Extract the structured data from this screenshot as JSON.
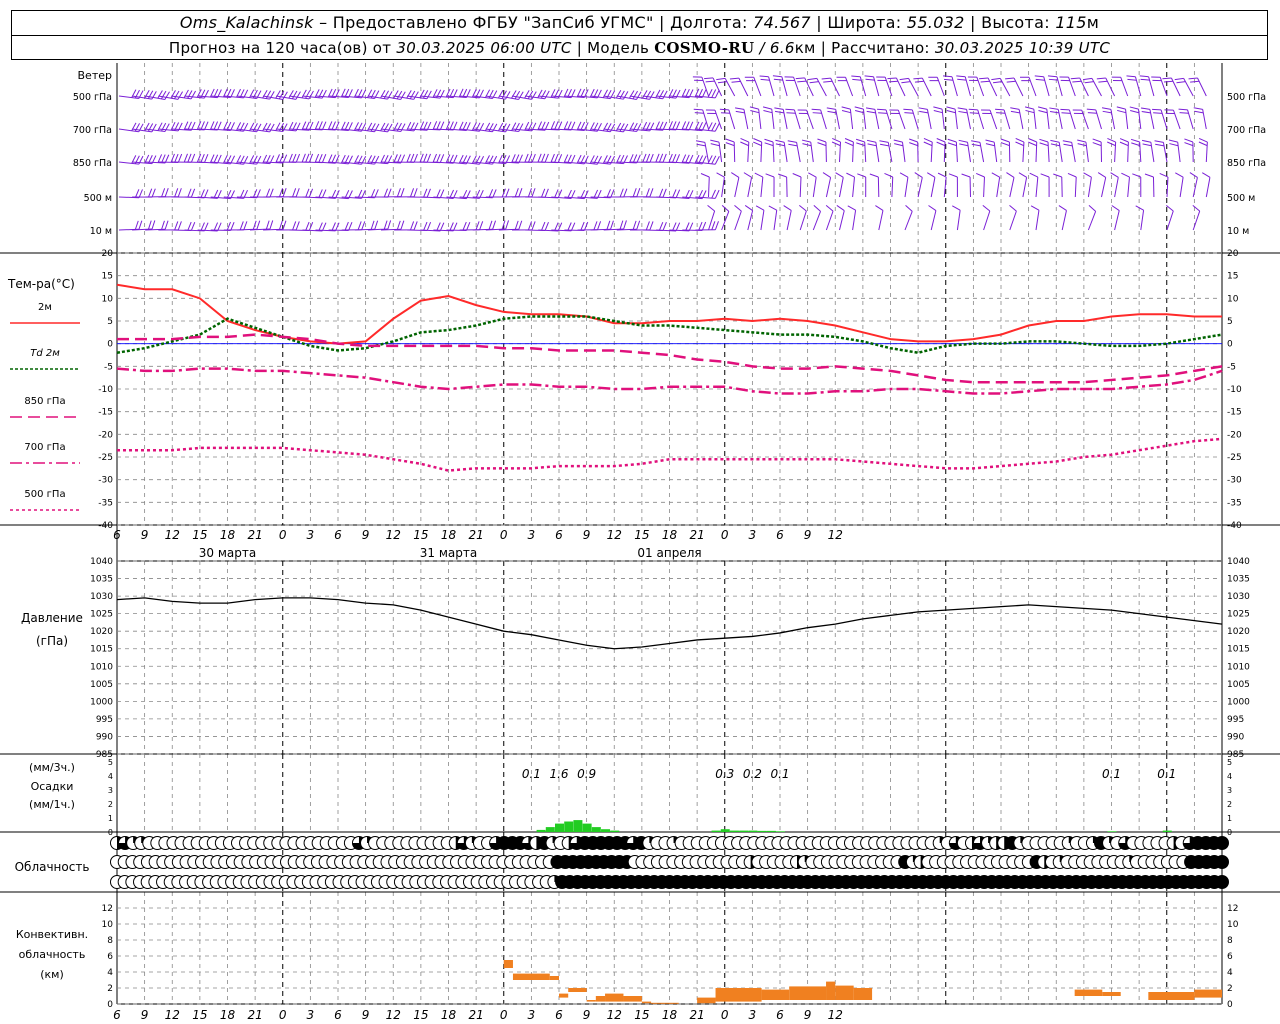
{
  "header": {
    "station": "Oms_Kalachinsk",
    "provided": "– Предоставлено ФГБУ \"ЗапСиб УГМС\"",
    "lon_label": "Долгота:",
    "lon": "74.567",
    "lat_label": "Широта:",
    "lat": "55.032",
    "alt_label": "Высота:",
    "alt": "115",
    "alt_unit": "м",
    "forecast_prefix": "Прогноз на 120 часа(ов) от",
    "forecast_time": "30.03.2025 06:00 UTC",
    "model_label": "Модель",
    "model": "COSMO-RU",
    "model_res": "/ 6.6",
    "model_res_unit": "км",
    "calc_label": "Рассчитано:",
    "calc_time": "30.03.2025 10:39 UTC"
  },
  "colors": {
    "wind": "#7a1fd6",
    "t2m": "#ff2a2a",
    "td2m": "#006400",
    "t850": "#e0107c",
    "t700": "#e0107c",
    "t500": "#e0107c",
    "zero_line": "#0000ff",
    "pressure": "#000000",
    "precip": "#22cc22",
    "convective": "#f08020",
    "grid": "#888888"
  },
  "chart_data": [
    {
      "type": "wind_barbs",
      "title": "Ветер",
      "levels": [
        "500 гПа",
        "700 гПа",
        "850 гПа",
        "500 м",
        "10 м"
      ]
    },
    {
      "type": "line",
      "ylabel": "Тем-ра(°C)",
      "ylim": [
        -40,
        20
      ],
      "yticks": [
        20,
        15,
        10,
        5,
        0,
        -5,
        -10,
        -15,
        -20,
        -25,
        -30,
        -35,
        -40
      ],
      "x_hours": [
        0,
        3,
        6,
        9,
        12,
        15,
        18,
        21,
        24,
        27,
        30,
        33,
        36,
        39,
        42,
        45,
        48,
        51,
        54,
        57,
        60,
        63,
        66,
        69,
        72,
        75,
        78,
        81,
        84,
        87,
        90,
        93,
        96,
        99,
        102,
        105,
        108,
        111,
        114,
        117,
        120
      ],
      "series": [
        {
          "name": "2м",
          "key": "t2m",
          "values": [
            13,
            12,
            12,
            10,
            5,
            3,
            1.5,
            0.5,
            0,
            0.5,
            5.5,
            9.5,
            10.5,
            8.5,
            7,
            6.5,
            6.5,
            6,
            4.5,
            4.5,
            5,
            5,
            5.5,
            5,
            5.5,
            5,
            4,
            2.5,
            1,
            0.5,
            0.5,
            1,
            2,
            4,
            5,
            5,
            6,
            6.5,
            6.5,
            6,
            6
          ]
        },
        {
          "name": "Td 2м",
          "key": "td2m",
          "values": [
            -2,
            -1,
            0.5,
            2,
            5.5,
            3.5,
            1.5,
            -0.5,
            -1.5,
            -1,
            0.5,
            2.5,
            3,
            4,
            5.5,
            6,
            6,
            6,
            5,
            4,
            4,
            3.5,
            3,
            2.5,
            2,
            2,
            1.5,
            0.5,
            -1,
            -2,
            -0.5,
            0,
            0,
            0.5,
            0.5,
            0,
            -0.5,
            -0.5,
            0,
            1,
            2
          ]
        },
        {
          "name": "850 гПа",
          "key": "t850",
          "values": [
            1,
            1,
            1,
            1.5,
            1.5,
            2,
            1.5,
            1,
            0,
            -0.5,
            -0.5,
            -0.5,
            -0.5,
            -0.5,
            -1,
            -1,
            -1.5,
            -1.5,
            -1.5,
            -2,
            -2.5,
            -3.5,
            -4,
            -5,
            -5.5,
            -5.5,
            -5,
            -5.5,
            -6,
            -7,
            -8,
            -8.5,
            -8.5,
            -8.5,
            -8.5,
            -8.5,
            -8,
            -7.5,
            -7,
            -6,
            -5
          ]
        },
        {
          "name": "700 гПа",
          "key": "t700",
          "values": [
            -5.5,
            -6,
            -6,
            -5.5,
            -5.5,
            -6,
            -6,
            -6.5,
            -7,
            -7.5,
            -8.5,
            -9.5,
            -10,
            -9.5,
            -9,
            -9,
            -9.5,
            -9.5,
            -10,
            -10,
            -9.5,
            -9.5,
            -9.5,
            -10.5,
            -11,
            -11,
            -10.5,
            -10.5,
            -10,
            -10,
            -10.5,
            -11,
            -11,
            -10.5,
            -10,
            -10,
            -10,
            -9.5,
            -9,
            -8,
            -6
          ]
        },
        {
          "name": "500 гПа",
          "key": "t500",
          "values": [
            -23.5,
            -23.5,
            -23.5,
            -23,
            -23,
            -23,
            -23,
            -23.5,
            -24,
            -24.5,
            -25.5,
            -26.5,
            -28,
            -27.5,
            -27.5,
            -27.5,
            -27,
            -27,
            -27,
            -26.5,
            -25.5,
            -25.5,
            -25.5,
            -25.5,
            -25.5,
            -25.5,
            -25.5,
            -26,
            -26.5,
            -27,
            -27.5,
            -27.5,
            -27,
            -26.5,
            -26,
            -25,
            -24.5,
            -23.5,
            -22.5,
            -21.5,
            -21
          ]
        }
      ]
    },
    {
      "type": "line",
      "ylabel": "Давление (гПа)",
      "ylim": [
        985,
        1040
      ],
      "yticks": [
        1040,
        1035,
        1030,
        1025,
        1020,
        1015,
        1010,
        1005,
        1000,
        995,
        990,
        985
      ],
      "x_hours": [
        0,
        3,
        6,
        9,
        12,
        15,
        18,
        21,
        24,
        27,
        30,
        33,
        36,
        39,
        42,
        45,
        48,
        51,
        54,
        57,
        60,
        63,
        66,
        69,
        72,
        75,
        78,
        81,
        84,
        87,
        90,
        93,
        96,
        99,
        102,
        105,
        108,
        111,
        114,
        117,
        120
      ],
      "series": [
        {
          "name": "Давление",
          "key": "pressure",
          "values": [
            1029,
            1029.5,
            1028.5,
            1028,
            1028,
            1029,
            1029.5,
            1029.5,
            1029,
            1028,
            1027.5,
            1026,
            1024,
            1022,
            1020,
            1019,
            1017.5,
            1016,
            1015,
            1015.5,
            1016.5,
            1017.5,
            1018,
            1018.5,
            1019.5,
            1021,
            1022,
            1023.5,
            1024.5,
            1025.5,
            1026,
            1026.5,
            1027,
            1027.5,
            1027,
            1026.5,
            1026,
            1025,
            1024,
            1023,
            1022
          ]
        }
      ]
    },
    {
      "type": "bar",
      "ylabel_top": "(мм/3ч.)",
      "ylabel_mid": "Осадки",
      "ylabel_bottom": "(мм/1ч.)",
      "ylim": [
        0,
        5
      ],
      "yticks": [
        5,
        4,
        3,
        2,
        1,
        0
      ],
      "annotations": [
        {
          "hour": 45,
          "text": "0.1"
        },
        {
          "hour": 48,
          "text": "1.6"
        },
        {
          "hour": 51,
          "text": "0.9"
        },
        {
          "hour": 66,
          "text": "0.3"
        },
        {
          "hour": 69,
          "text": "0.2"
        },
        {
          "hour": 72,
          "text": "0.1"
        },
        {
          "hour": 108,
          "text": "0.1"
        },
        {
          "hour": 114,
          "text": "0.1"
        }
      ],
      "bars": [
        {
          "hour": 46,
          "value": 0.15
        },
        {
          "hour": 47,
          "value": 0.35
        },
        {
          "hour": 48,
          "value": 0.6
        },
        {
          "hour": 49,
          "value": 0.75
        },
        {
          "hour": 50,
          "value": 0.85
        },
        {
          "hour": 51,
          "value": 0.6
        },
        {
          "hour": 52,
          "value": 0.35
        },
        {
          "hour": 53,
          "value": 0.2
        },
        {
          "hour": 54,
          "value": 0.1
        },
        {
          "hour": 65,
          "value": 0.1
        },
        {
          "hour": 66,
          "value": 0.2
        },
        {
          "hour": 67,
          "value": 0.1
        },
        {
          "hour": 68,
          "value": 0.1
        },
        {
          "hour": 69,
          "value": 0.1
        },
        {
          "hour": 70,
          "value": 0.08
        },
        {
          "hour": 71,
          "value": 0.08
        },
        {
          "hour": 72,
          "value": 0.05
        },
        {
          "hour": 108,
          "value": 0.05
        },
        {
          "hour": 114,
          "value": 0.1
        }
      ]
    },
    {
      "type": "cloud_cover",
      "ylabel": "Облачность",
      "rows": [
        [
          2,
          3,
          1,
          1,
          0,
          0,
          0,
          0,
          0,
          0,
          0,
          0,
          0,
          0,
          0,
          0,
          0,
          0,
          0,
          0,
          0,
          0,
          0,
          0,
          0,
          0,
          0,
          0,
          0,
          0,
          3,
          1,
          0,
          0,
          0,
          0,
          0,
          0,
          0,
          0,
          0,
          0,
          2,
          3,
          1,
          0,
          0,
          3,
          4,
          4,
          4,
          3,
          2,
          4,
          1,
          0,
          2,
          3,
          4,
          4,
          4,
          4,
          4,
          4,
          3,
          4,
          1,
          0,
          0,
          1,
          0,
          0,
          0,
          0,
          0,
          0,
          0,
          0,
          0,
          0,
          0,
          0,
          0,
          0,
          0,
          0,
          0,
          0,
          0,
          0,
          0,
          0,
          0,
          0,
          0,
          0,
          0,
          0,
          0,
          0,
          0,
          0,
          1,
          0,
          3,
          0,
          2,
          3,
          1,
          2,
          2,
          4,
          1,
          0,
          0,
          0,
          0,
          0,
          1,
          0,
          0,
          1,
          4,
          1,
          0,
          3,
          0,
          0,
          0,
          0,
          0,
          2,
          0,
          3,
          4,
          4,
          4,
          4
        ],
        [
          0,
          0,
          0,
          0,
          0,
          0,
          0,
          0,
          0,
          0,
          0,
          0,
          0,
          0,
          0,
          0,
          0,
          0,
          0,
          0,
          0,
          0,
          0,
          0,
          0,
          0,
          0,
          0,
          0,
          0,
          0,
          0,
          0,
          0,
          0,
          0,
          0,
          0,
          0,
          0,
          0,
          0,
          0,
          0,
          0,
          0,
          0,
          0,
          0,
          0,
          0,
          0,
          0,
          0,
          0,
          0,
          0,
          4,
          4,
          4,
          4,
          4,
          4,
          4,
          4,
          4,
          4,
          0,
          0,
          0,
          0,
          0,
          0,
          0,
          0,
          0,
          0,
          0,
          0,
          0,
          0,
          0,
          2,
          0,
          0,
          0,
          0,
          0,
          2,
          1,
          0,
          0,
          0,
          0,
          0,
          0,
          0,
          0,
          0,
          0,
          0,
          0,
          4,
          1,
          2,
          0,
          0,
          0,
          0,
          0,
          0,
          0,
          0,
          0,
          0,
          0,
          0,
          0,
          0,
          4,
          2,
          0,
          1,
          0,
          0,
          0,
          0,
          0,
          0,
          0,
          0,
          1,
          0,
          0,
          0,
          0,
          0,
          0,
          0,
          4,
          4,
          4,
          4,
          4
        ],
        [
          0,
          0,
          0,
          0,
          0,
          0,
          0,
          0,
          0,
          0,
          0,
          0,
          0,
          0,
          0,
          0,
          0,
          0,
          0,
          0,
          0,
          0,
          0,
          0,
          0,
          0,
          0,
          0,
          0,
          0,
          0,
          0,
          0,
          0,
          0,
          0,
          0,
          0,
          0,
          0,
          0,
          0,
          0,
          0,
          0,
          0,
          0,
          0,
          0,
          0,
          0,
          0,
          0,
          0,
          0,
          0,
          0,
          1,
          4,
          4,
          4,
          4,
          4,
          4,
          4,
          4,
          4,
          4,
          4,
          4,
          4,
          4,
          4,
          4,
          4,
          4,
          4,
          4,
          4,
          4,
          4,
          4,
          4,
          4,
          4,
          4,
          4,
          4,
          4,
          4,
          4,
          4,
          4,
          4,
          4,
          4,
          4,
          4,
          4,
          4,
          4,
          4,
          4,
          4,
          4,
          4,
          4,
          4,
          4,
          4,
          4,
          4,
          4,
          4,
          4,
          4,
          4,
          4,
          4,
          4,
          4,
          4,
          4,
          4,
          4,
          4,
          4,
          4,
          4,
          4,
          4,
          4,
          4,
          4,
          4,
          4,
          4,
          4,
          4,
          4,
          4,
          4,
          4,
          4,
          4
        ]
      ]
    },
    {
      "type": "bar",
      "ylabel_l1": "Конвективн.",
      "ylabel_l2": "облачность",
      "ylabel_l3": "(км)",
      "ylim": [
        0,
        14
      ],
      "yticks": [
        12,
        10,
        8,
        6,
        4,
        2,
        0
      ],
      "layers": [
        {
          "h0": 42,
          "h1": 43,
          "bottom": 4.5,
          "top": 5.5
        },
        {
          "h0": 43,
          "h1": 47,
          "bottom": 3,
          "top": 3.8
        },
        {
          "h0": 47,
          "h1": 48,
          "bottom": 3,
          "top": 3.5
        },
        {
          "h0": 48,
          "h1": 49,
          "bottom": 0.8,
          "top": 1.3
        },
        {
          "h0": 49,
          "h1": 51,
          "bottom": 1.5,
          "top": 2
        },
        {
          "h0": 51,
          "h1": 52,
          "bottom": 0.3,
          "top": 0.5
        },
        {
          "h0": 52,
          "h1": 53,
          "bottom": 0.3,
          "top": 1
        },
        {
          "h0": 53,
          "h1": 55,
          "bottom": 0.3,
          "top": 1.3
        },
        {
          "h0": 55,
          "h1": 57,
          "bottom": 0.3,
          "top": 1
        },
        {
          "h0": 57,
          "h1": 58,
          "bottom": 0.1,
          "top": 0.3
        },
        {
          "h0": 58,
          "h1": 61,
          "bottom": 0.05,
          "top": 0.15
        },
        {
          "h0": 63,
          "h1": 65,
          "bottom": 0.1,
          "top": 0.8
        },
        {
          "h0": 65,
          "h1": 70,
          "bottom": 0.3,
          "top": 2
        },
        {
          "h0": 70,
          "h1": 73,
          "bottom": 0.5,
          "top": 1.8
        },
        {
          "h0": 73,
          "h1": 77,
          "bottom": 0.5,
          "top": 2.2
        },
        {
          "h0": 77,
          "h1": 78,
          "bottom": 0.5,
          "top": 2.8
        },
        {
          "h0": 78,
          "h1": 80,
          "bottom": 0.5,
          "top": 2.3
        },
        {
          "h0": 80,
          "h1": 82,
          "bottom": 0.5,
          "top": 2
        },
        {
          "h0": 104,
          "h1": 107,
          "bottom": 1,
          "top": 1.8
        },
        {
          "h0": 107,
          "h1": 109,
          "bottom": 1,
          "top": 1.5
        },
        {
          "h0": 112,
          "h1": 117,
          "bottom": 0.5,
          "top": 1.5
        },
        {
          "h0": 117,
          "h1": 120,
          "bottom": 0.8,
          "top": 1.8
        }
      ]
    }
  ],
  "x_axis": {
    "tick_labels": [
      "6",
      "9",
      "12",
      "15",
      "18",
      "21",
      "0",
      "3",
      "6",
      "9",
      "12",
      "15",
      "18",
      "21",
      "0",
      "3",
      "6",
      "9",
      "12",
      "15",
      "18",
      "21",
      "0",
      "3",
      "6",
      "9",
      "12"
    ],
    "dates": [
      {
        "hour": 6,
        "label": "30 марта"
      },
      {
        "hour": 30,
        "label": "31 марта"
      },
      {
        "hour": 54,
        "label": "01 апреля"
      }
    ]
  }
}
